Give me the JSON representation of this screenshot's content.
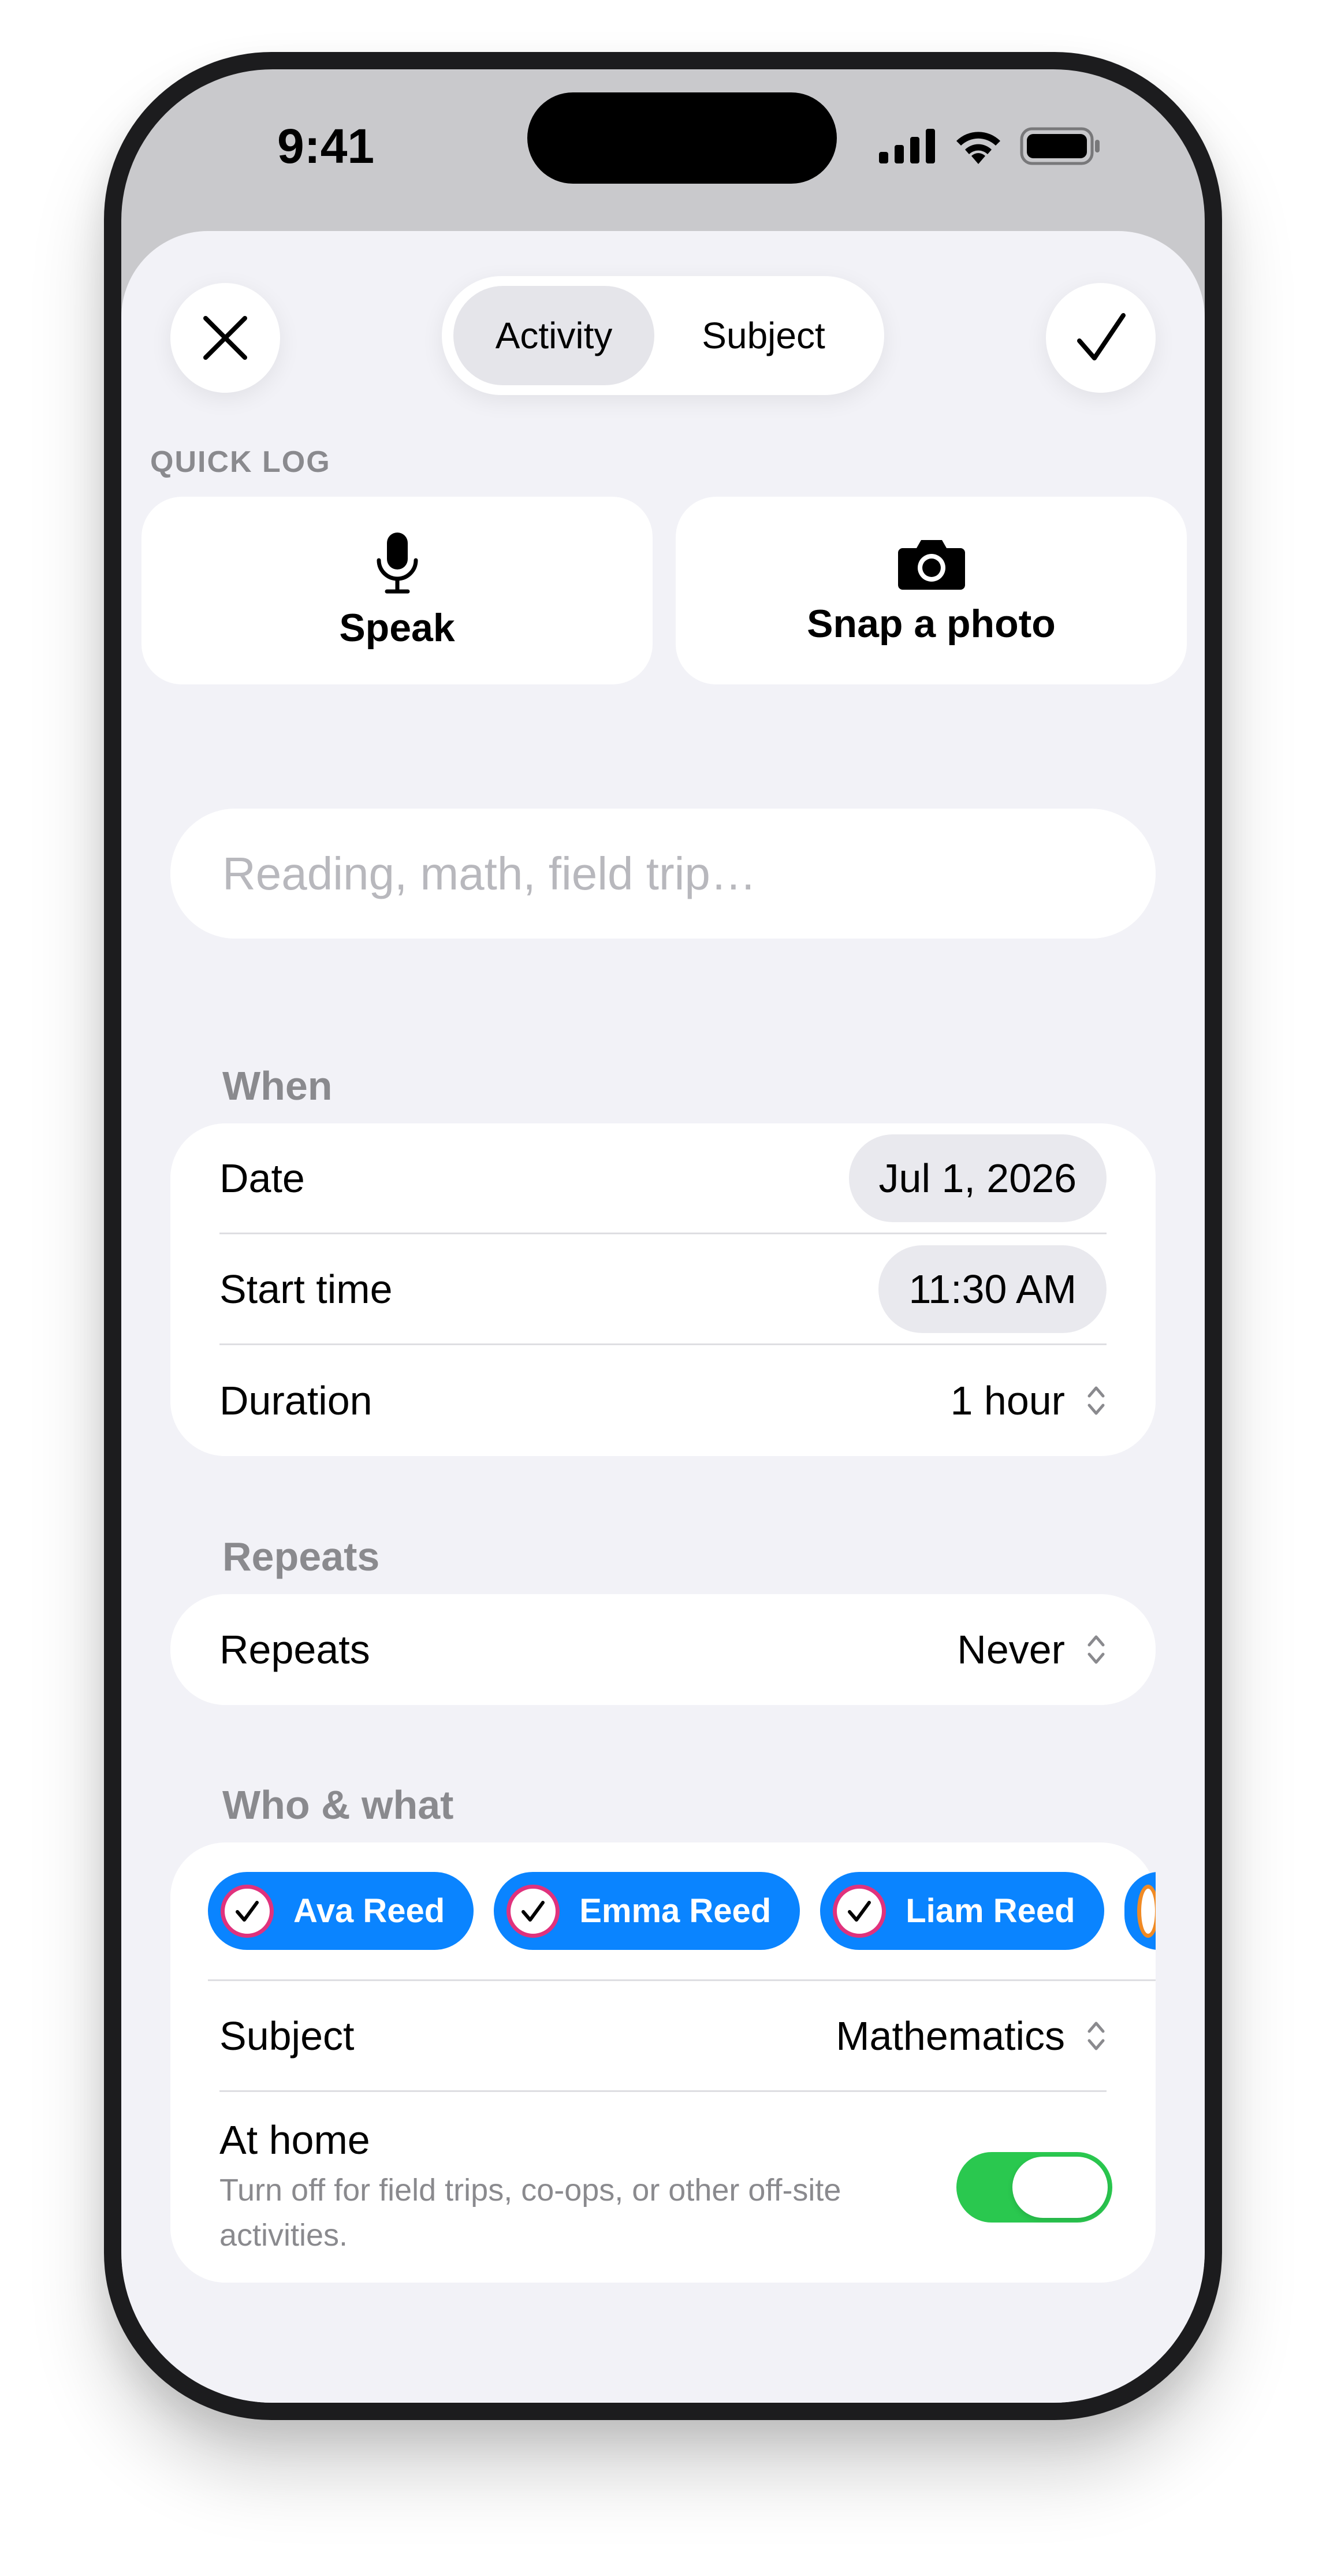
{
  "status_bar": {
    "time": "9:41"
  },
  "header": {
    "tabs": [
      {
        "label": "Activity",
        "selected": true
      },
      {
        "label": "Subject",
        "selected": false
      }
    ]
  },
  "quick_log": {
    "label": "QUICK LOG",
    "actions": [
      {
        "label": "Speak",
        "icon": "microphone-icon"
      },
      {
        "label": "Snap a photo",
        "icon": "camera-icon"
      }
    ]
  },
  "activity_field": {
    "placeholder": "Reading, math, field trip…",
    "value": ""
  },
  "when": {
    "label": "When",
    "rows": [
      {
        "label": "Date",
        "value": "Jul 1, 2026"
      },
      {
        "label": "Start time",
        "value": "11:30 AM"
      },
      {
        "label": "Duration",
        "value": "1 hour"
      }
    ]
  },
  "repeats": {
    "label": "Repeats",
    "row": {
      "label": "Repeats",
      "value": "Never"
    }
  },
  "who_what": {
    "label": "Who & what",
    "students": [
      {
        "name": "Ava Reed",
        "selected": true,
        "ring_color": "#e0327d"
      },
      {
        "name": "Emma Reed",
        "selected": true,
        "ring_color": "#e0327d"
      },
      {
        "name": "Liam Reed",
        "selected": true,
        "ring_color": "#e0327d"
      }
    ],
    "subject": {
      "label": "Subject",
      "value": "Mathematics"
    },
    "at_home": {
      "label": "At home",
      "description": "Turn off for field trips, co-ops, or other off-site activities.",
      "enabled": true
    }
  },
  "colors": {
    "accent": "#0a84ff",
    "toggle_on": "#2ac84f",
    "background": "#f2f2f7"
  }
}
